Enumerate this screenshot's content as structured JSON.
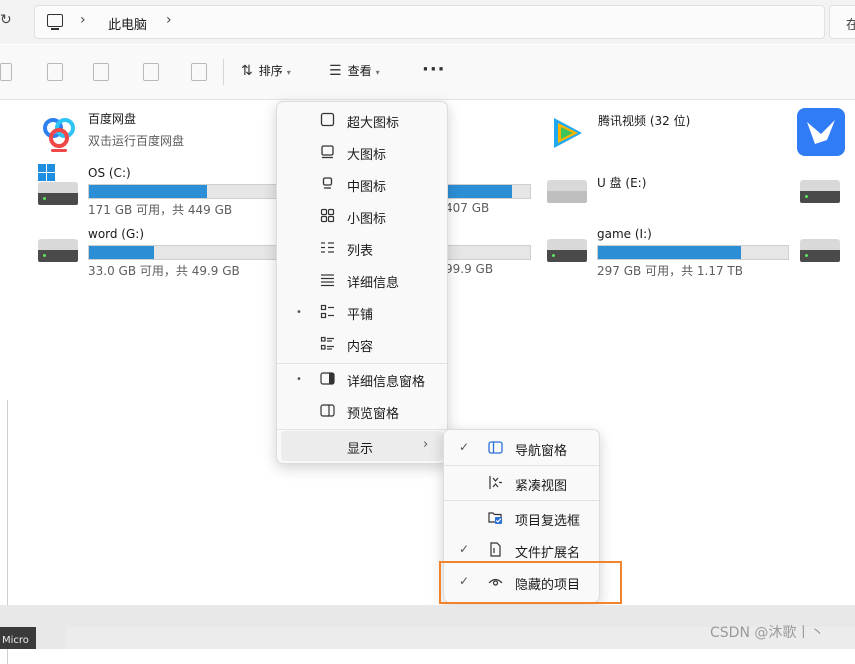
{
  "address": {
    "crumb": "此电脑",
    "separator": "›",
    "search_hint": "在"
  },
  "toolbar": {
    "sort_label": "排序",
    "view_label": "查看",
    "more_label": "···"
  },
  "items": {
    "baidu": {
      "name": "百度网盘",
      "sub": "双击运行百度网盘"
    },
    "tencent": {
      "name": "腾讯视频 (32 位)"
    },
    "drive_c": {
      "name": "OS (C:)",
      "sub": "171 GB 可用，共 449 GB",
      "used_fraction": 0.62
    },
    "drive_d": {
      "sub": "407 GB",
      "used_fraction": 0.8
    },
    "drive_e": {
      "name": "U 盘 (E:)"
    },
    "drive_g": {
      "name": "word (G:)",
      "sub": "33.0 GB 可用，共 49.9 GB",
      "used_fraction": 0.34
    },
    "drive_h": {
      "sub": "99.9 GB"
    },
    "drive_i": {
      "name": "game (I:)",
      "sub": "297 GB 可用，共 1.17 TB",
      "used_fraction": 0.75
    }
  },
  "menu": {
    "extra_large": "超大图标",
    "large": "大图标",
    "medium": "中图标",
    "small": "小图标",
    "list": "列表",
    "details": "详细信息",
    "tiles": "平铺",
    "content": "内容",
    "details_pane": "详细信息窗格",
    "preview_pane": "预览窗格",
    "show": "显示",
    "bullet": "•",
    "arrow": "›"
  },
  "submenu": {
    "nav_pane": "导航窗格",
    "compact": "紧凑视图",
    "checkboxes": "项目复选框",
    "extensions": "文件扩展名",
    "hidden": "隐藏的项目",
    "check": "✓"
  },
  "taskbar": {
    "label": "Micro"
  },
  "watermark": "CSDN @沐歌丨丶",
  "colors": {
    "accent": "#2c8fd6",
    "highlight": "#f0832b"
  }
}
